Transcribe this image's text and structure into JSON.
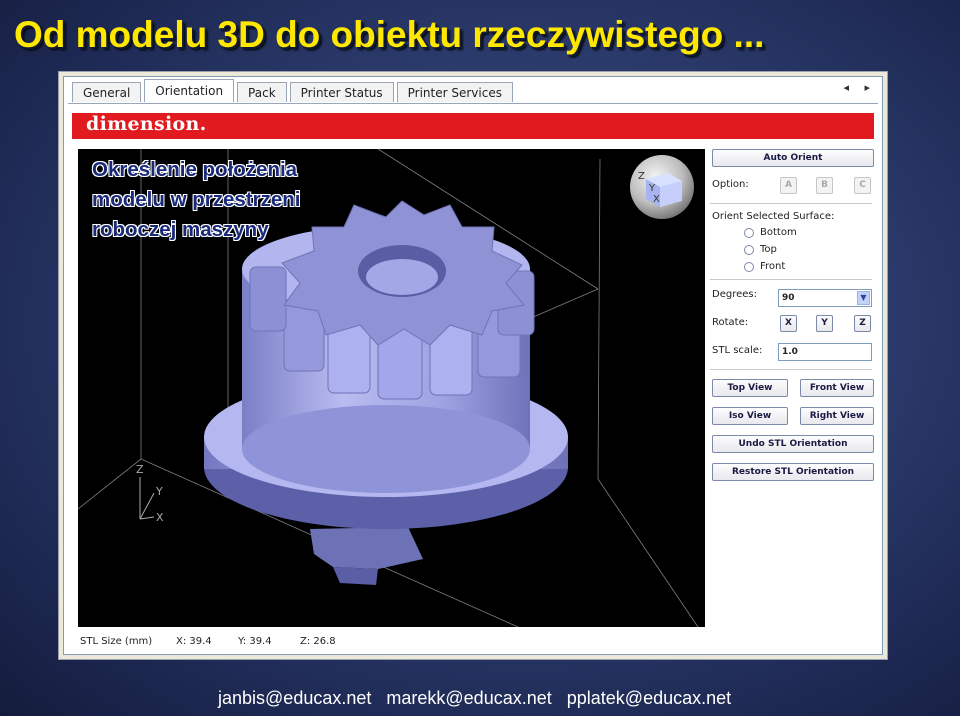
{
  "slide": {
    "title": "Od modelu 3D do obiektu rzeczywistego ..."
  },
  "window": {
    "tabs": [
      "General",
      "Orientation",
      "Pack",
      "Printer Status",
      "Printer Services"
    ],
    "active_tab": "Orientation",
    "tab_arrows": "◂ ▸",
    "brand": "dimension."
  },
  "viewport": {
    "overlay_lines": [
      "Określenie położenia",
      "modelu w przestrzeni",
      "roboczej maszyny"
    ],
    "axes": {
      "z": "Z",
      "y": "Y",
      "x": "X"
    },
    "cube_axes": {
      "z": "Z",
      "y": "Y",
      "x": "X"
    }
  },
  "status": {
    "label": "STL Size (mm)",
    "x": "X: 39.4",
    "y": "Y: 39.4",
    "z": "Z: 26.8"
  },
  "panel": {
    "auto_orient": "Auto Orient",
    "option_label": "Option:",
    "options": [
      "A",
      "B",
      "C"
    ],
    "orient_surface_label": "Orient Selected Surface:",
    "surfaces": [
      "Bottom",
      "Top",
      "Front"
    ],
    "degrees_label": "Degrees:",
    "degrees_value": "90",
    "rotate_label": "Rotate:",
    "rotate_axes": [
      "X",
      "Y",
      "Z"
    ],
    "stl_scale_label": "STL scale:",
    "stl_scale_value": "1.0",
    "top_view": "Top View",
    "front_view": "Front View",
    "iso_view": "Iso View",
    "right_view": "Right View",
    "undo": "Undo STL Orientation",
    "restore": "Restore STL Orientation"
  },
  "footer": {
    "emails": [
      "janbis@educax.net",
      "marekk@educax.net",
      "pplatek@educax.net"
    ]
  },
  "colors": {
    "title": "#ffe800",
    "brand_bar": "#e01a1f",
    "model": "#9a9ee0",
    "viewport_bg": "#000000"
  }
}
